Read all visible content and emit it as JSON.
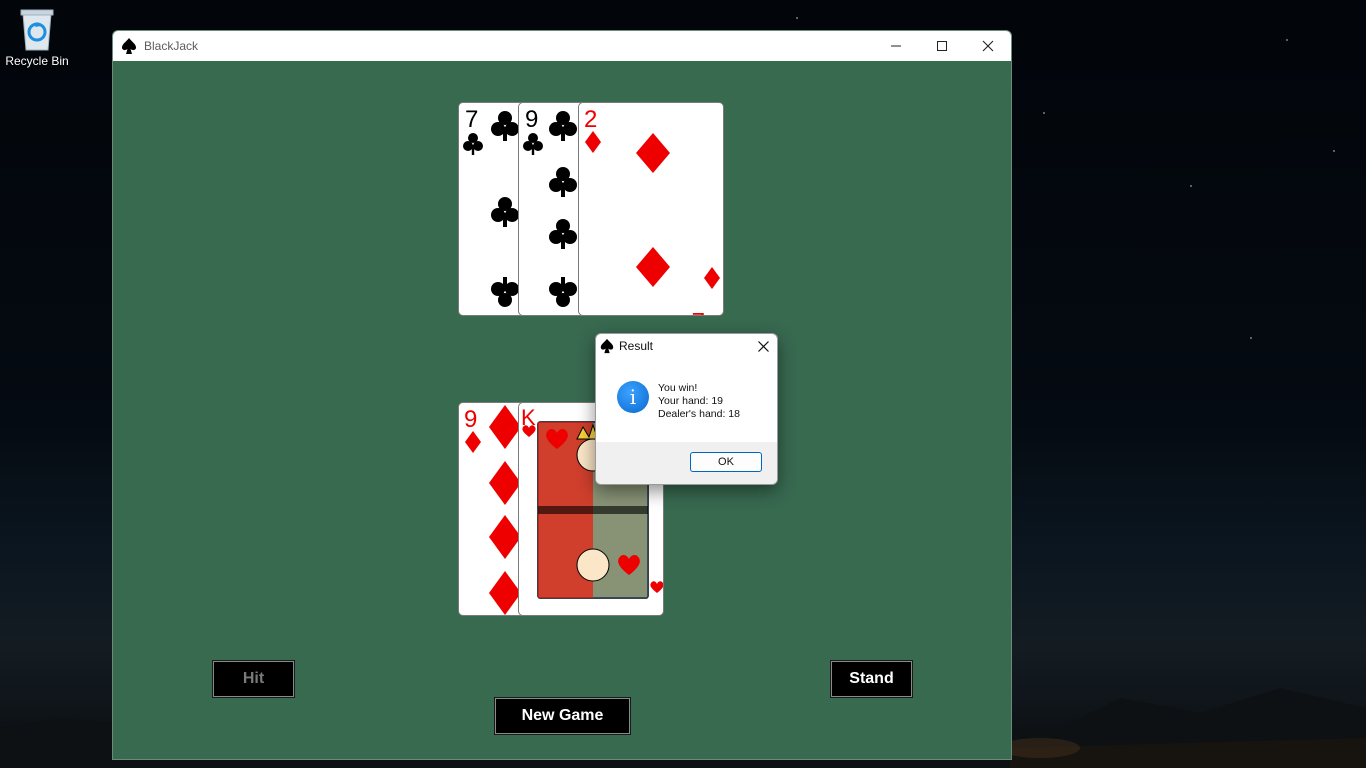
{
  "desktop": {
    "recycle_bin_label": "Recycle Bin"
  },
  "window": {
    "title": "BlackJack",
    "background_color": "#386a50"
  },
  "dealer_hand": [
    {
      "rank": "7",
      "suit": "clubs"
    },
    {
      "rank": "9",
      "suit": "clubs"
    },
    {
      "rank": "2",
      "suit": "diamonds"
    }
  ],
  "player_hand": [
    {
      "rank": "9",
      "suit": "diamonds"
    },
    {
      "rank": "K",
      "suit": "hearts"
    }
  ],
  "buttons": {
    "hit_label": "Hit",
    "stand_label": "Stand",
    "new_game_label": "New Game"
  },
  "dialog": {
    "title": "Result",
    "line1": "You win!",
    "line2": "Your hand: 19",
    "line3": "Dealer's hand: 18",
    "ok_label": "OK",
    "icon": "info-icon"
  }
}
